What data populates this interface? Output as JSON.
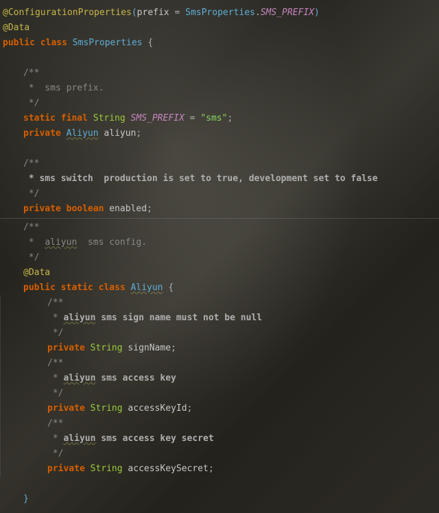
{
  "code": {
    "l1_ann": "@ConfigurationProperties",
    "l1_prefixKey": "prefix",
    "l1_eq": " = ",
    "l1_cls": "SmsProperties",
    "l1_dot": ".",
    "l1_const": "SMS_PREFIX",
    "l2": "@Data",
    "l3_kw": "public class ",
    "l3_cls": "SmsProperties",
    "l3_sp": " ",
    "l3_brace": "{",
    "c1_a": "/**",
    "c1_b": " *  sms prefix.",
    "c1_c": " */",
    "f1_kw": "static final ",
    "f1_type": "String",
    "f1_sp": " ",
    "f1_name": "SMS_PREFIX",
    "f1_eq": " = ",
    "f1_val": "\"sms\"",
    "f1_semi": ";",
    "f2_kw": "private ",
    "f2_type": "Aliyun",
    "f2_sp": " ",
    "f2_name": "aliyun",
    "f2_semi": ";",
    "c2_a": "/**",
    "c2_b": " * sms switch  production is set to true, development set to false",
    "c2_c": " */",
    "f3_kw": "private boolean ",
    "f3_name": "enabled",
    "f3_semi": ";",
    "c3_a": "/**",
    "c3_b": " *  ",
    "c3_b_u": "aliyun",
    "c3_b2": "  sms config.",
    "c3_c": " */",
    "inner_ann": "@Data",
    "inner_kw": "public static class ",
    "inner_cls": "Aliyun",
    "inner_sp": " ",
    "inner_brace": "{",
    "ic1_a": "/**",
    "ic1_b": " * ",
    "ic1_b_u": "aliyun",
    "ic1_b2": " sms sign name must not be null",
    "ic1_c": " */",
    "if1_kw": "private ",
    "if1_type": "String",
    "if1_sp": " ",
    "if1_name": "signName",
    "if1_semi": ";",
    "ic2_a": "/**",
    "ic2_b": " * ",
    "ic2_b_u": "aliyun",
    "ic2_b2": " sms access key",
    "ic2_c": " */",
    "if2_kw": "private ",
    "if2_type": "String",
    "if2_sp": " ",
    "if2_name": "accessKeyId",
    "if2_semi": ";",
    "ic3_a": "/**",
    "ic3_b": " * ",
    "ic3_b_u": "aliyun",
    "ic3_b2": " sms access key secret",
    "ic3_c": " */",
    "if3_kw": "private ",
    "if3_type": "String",
    "if3_sp": " ",
    "if3_name": "accessKeySecret",
    "if3_semi": ";",
    "inner_close": "}"
  }
}
